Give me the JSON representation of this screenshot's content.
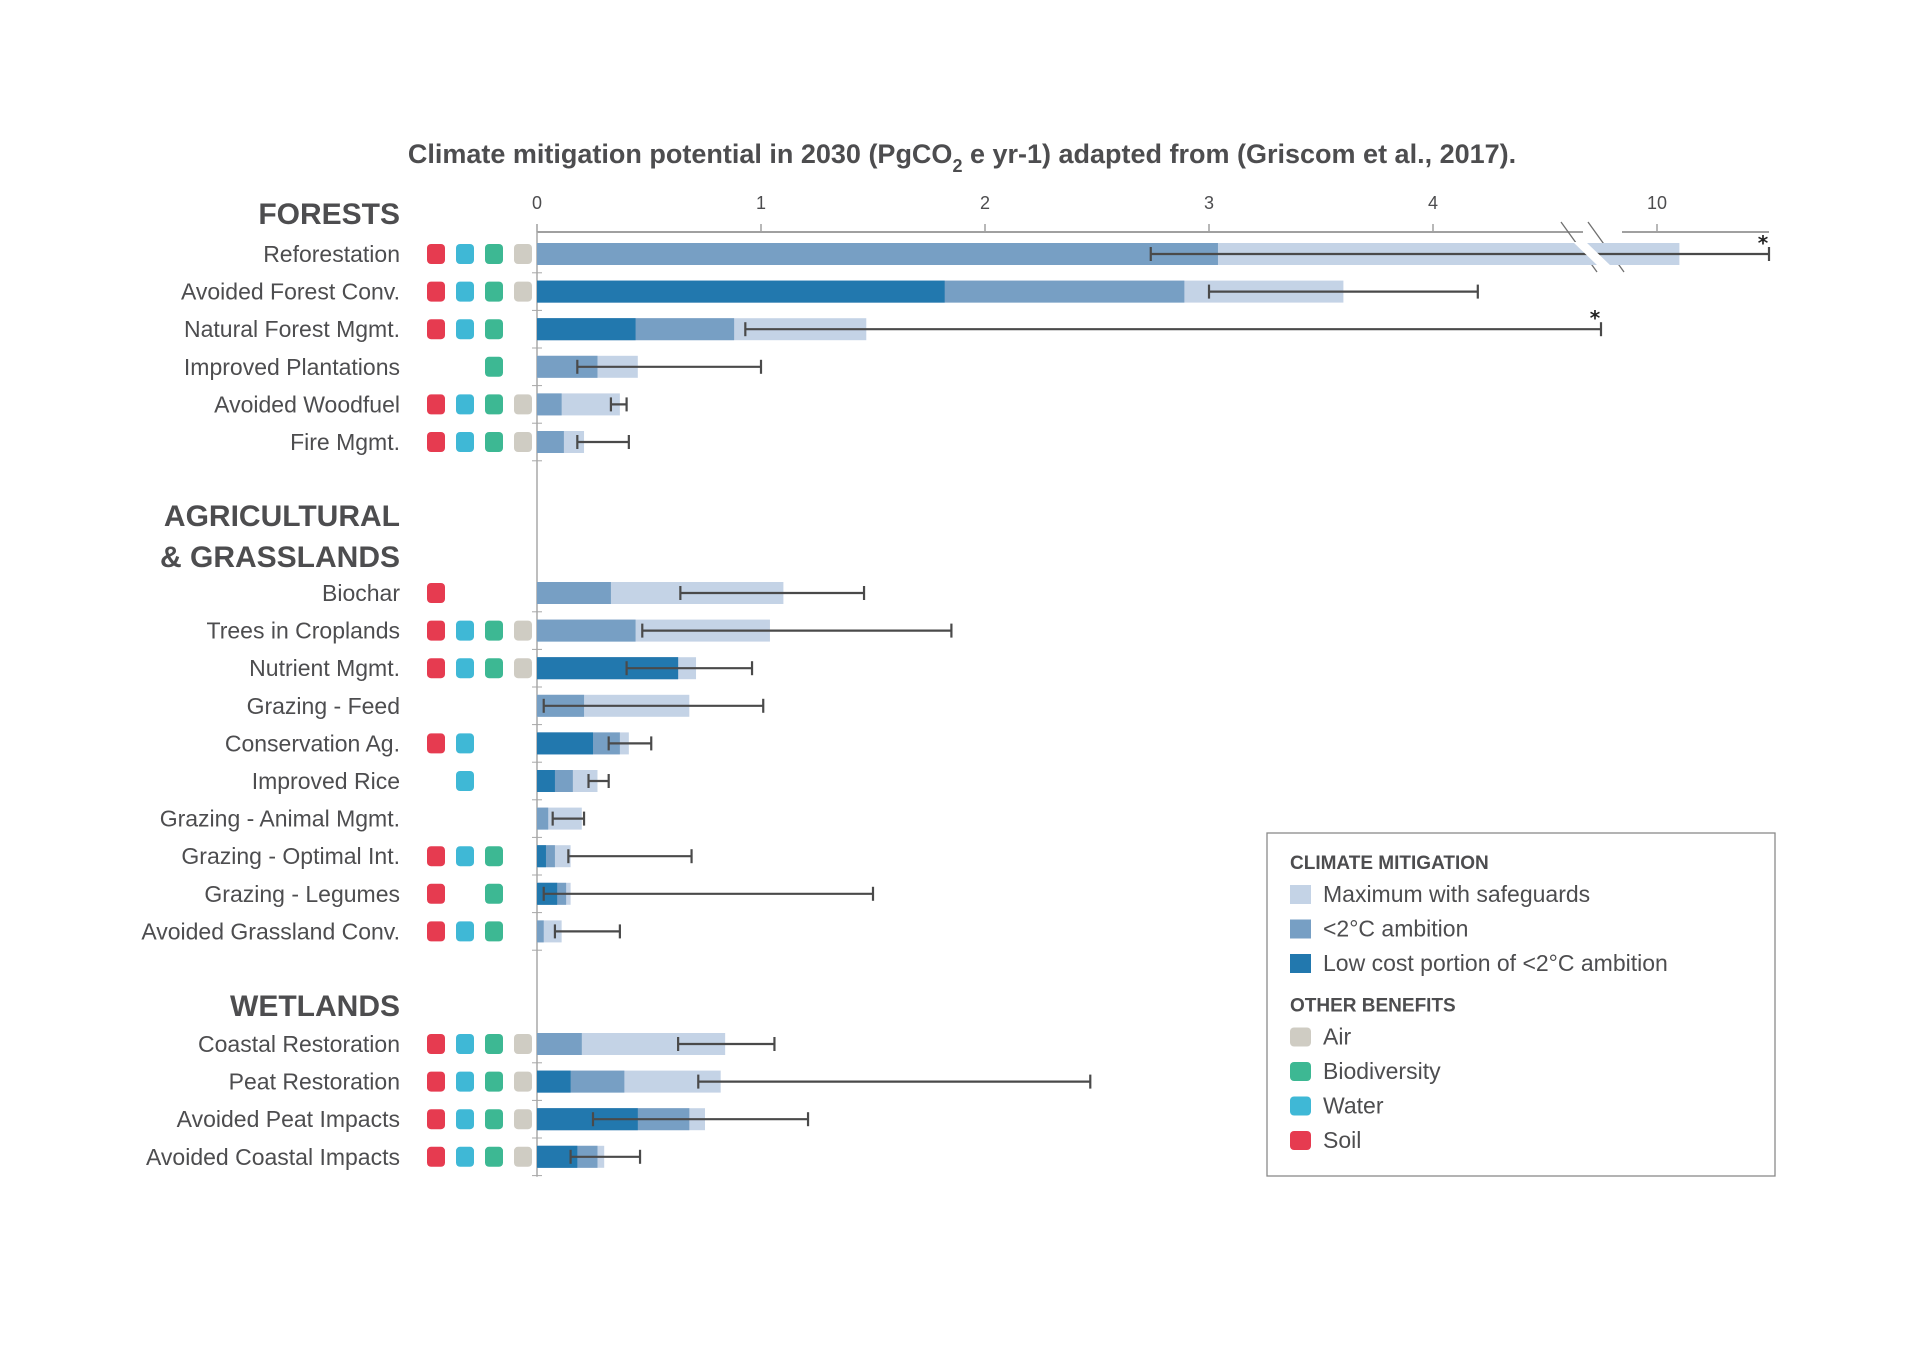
{
  "chart_data": {
    "type": "bar",
    "orientation": "horizontal",
    "stacked": true,
    "title_parts": {
      "before": "Climate mitigation potential in 2030 (PgCO",
      "subscript": "2",
      "after": " e yr-1) adapted from (Griscom et al., 2017)."
    },
    "title": "Climate mitigation potential in 2030 (PgCO2 e yr-1) adapted from (Griscom et al., 2017).",
    "xlabel": "",
    "ylabel": "",
    "x_ticks": [
      0,
      1,
      2,
      3,
      4,
      10
    ],
    "x_tick_labels": [
      "0",
      "1",
      "2",
      "3",
      "4",
      "10"
    ],
    "xlim": [
      0,
      10.5
    ],
    "axis_break": {
      "from": 4.8,
      "to": 9.8
    },
    "grid": false,
    "series": [
      {
        "key": "max",
        "name": "Maximum with safeguards",
        "color": "#C4D3E6"
      },
      {
        "key": "ambition",
        "name": "<2°C ambition",
        "color": "#779FC4"
      },
      {
        "key": "lowcost",
        "name": "Low cost portion of <2°C ambition",
        "color": "#2278AE"
      }
    ],
    "benefit_types": [
      {
        "key": "soil",
        "name": "Soil",
        "color": "#E63B50"
      },
      {
        "key": "water",
        "name": "Water",
        "color": "#3FB8D6"
      },
      {
        "key": "biodiversity",
        "name": "Biodiversity",
        "color": "#3DB893"
      },
      {
        "key": "air",
        "name": "Air",
        "color": "#CFCCC3"
      }
    ],
    "groups": [
      {
        "name": "FORESTS",
        "name_lines": [
          "FORESTS"
        ],
        "rows": [
          {
            "label": "Reforestation",
            "lowcost": 0,
            "ambition": 3.04,
            "max": 10.1,
            "err": [
              2.74,
              10.5
            ],
            "truncated": true,
            "benefits": [
              "soil",
              "water",
              "biodiversity",
              "air"
            ]
          },
          {
            "label": "Avoided Forest Conv.",
            "lowcost": 1.82,
            "ambition": 2.89,
            "max": 3.6,
            "err": [
              3.0,
              4.2
            ],
            "truncated": false,
            "benefits": [
              "soil",
              "water",
              "biodiversity",
              "air"
            ]
          },
          {
            "label": "Natural Forest Mgmt.",
            "lowcost": 0.44,
            "ambition": 0.88,
            "max": 1.47,
            "err": [
              0.93,
              4.75
            ],
            "truncated": true,
            "benefits": [
              "soil",
              "water",
              "biodiversity"
            ]
          },
          {
            "label": "Improved Plantations",
            "lowcost": 0,
            "ambition": 0.27,
            "max": 0.45,
            "err": [
              0.18,
              1.0
            ],
            "truncated": false,
            "benefits": [
              "biodiversity"
            ]
          },
          {
            "label": "Avoided Woodfuel",
            "lowcost": 0,
            "ambition": 0.11,
            "max": 0.37,
            "err": [
              0.33,
              0.4
            ],
            "truncated": false,
            "benefits": [
              "soil",
              "water",
              "biodiversity",
              "air"
            ]
          },
          {
            "label": "Fire Mgmt.",
            "lowcost": 0,
            "ambition": 0.12,
            "max": 0.21,
            "err": [
              0.18,
              0.41
            ],
            "truncated": false,
            "benefits": [
              "soil",
              "water",
              "biodiversity",
              "air"
            ]
          }
        ]
      },
      {
        "name": "AGRICULTURAL & GRASSLANDS",
        "name_lines": [
          "AGRICULTURAL",
          "& GRASSLANDS"
        ],
        "rows": [
          {
            "label": "Biochar",
            "lowcost": 0,
            "ambition": 0.33,
            "max": 1.1,
            "err": [
              0.64,
              1.46
            ],
            "truncated": false,
            "benefits": [
              "soil"
            ]
          },
          {
            "label": "Trees in Croplands",
            "lowcost": 0,
            "ambition": 0.44,
            "max": 1.04,
            "err": [
              0.47,
              1.85
            ],
            "truncated": false,
            "benefits": [
              "soil",
              "water",
              "biodiversity",
              "air"
            ]
          },
          {
            "label": "Nutrient Mgmt.",
            "lowcost": 0.63,
            "ambition": 0.63,
            "max": 0.71,
            "err": [
              0.4,
              0.96
            ],
            "truncated": false,
            "benefits": [
              "soil",
              "water",
              "biodiversity",
              "air"
            ]
          },
          {
            "label": "Grazing - Feed",
            "lowcost": 0,
            "ambition": 0.21,
            "max": 0.68,
            "err": [
              0.03,
              1.01
            ],
            "truncated": false,
            "benefits": []
          },
          {
            "label": "Conservation Ag.",
            "lowcost": 0.25,
            "ambition": 0.37,
            "max": 0.41,
            "err": [
              0.32,
              0.51
            ],
            "truncated": false,
            "benefits": [
              "soil",
              "water"
            ]
          },
          {
            "label": "Improved Rice",
            "lowcost": 0.08,
            "ambition": 0.16,
            "max": 0.27,
            "err": [
              0.23,
              0.32
            ],
            "truncated": false,
            "benefits": [
              "water"
            ]
          },
          {
            "label": "Grazing - Animal Mgmt.",
            "lowcost": 0,
            "ambition": 0.05,
            "max": 0.2,
            "err": [
              0.07,
              0.21
            ],
            "truncated": false,
            "benefits": []
          },
          {
            "label": "Grazing - Optimal Int.",
            "lowcost": 0.04,
            "ambition": 0.08,
            "max": 0.15,
            "err": [
              0.14,
              0.69
            ],
            "truncated": false,
            "benefits": [
              "soil",
              "water",
              "biodiversity"
            ]
          },
          {
            "label": "Grazing - Legumes",
            "lowcost": 0.09,
            "ambition": 0.13,
            "max": 0.15,
            "err": [
              0.03,
              1.5
            ],
            "truncated": false,
            "benefits": [
              "soil",
              "biodiversity"
            ]
          },
          {
            "label": "Avoided Grassland Conv.",
            "lowcost": 0,
            "ambition": 0.03,
            "max": 0.11,
            "err": [
              0.08,
              0.37
            ],
            "truncated": false,
            "benefits": [
              "soil",
              "water",
              "biodiversity"
            ]
          }
        ]
      },
      {
        "name": "WETLANDS",
        "name_lines": [
          "WETLANDS"
        ],
        "rows": [
          {
            "label": "Coastal Restoration",
            "lowcost": 0,
            "ambition": 0.2,
            "max": 0.84,
            "err": [
              0.63,
              1.06
            ],
            "truncated": false,
            "benefits": [
              "soil",
              "water",
              "biodiversity",
              "air"
            ]
          },
          {
            "label": "Peat Restoration",
            "lowcost": 0.15,
            "ambition": 0.39,
            "max": 0.82,
            "err": [
              0.72,
              2.47
            ],
            "truncated": false,
            "benefits": [
              "soil",
              "water",
              "biodiversity",
              "air"
            ]
          },
          {
            "label": "Avoided Peat Impacts",
            "lowcost": 0.45,
            "ambition": 0.68,
            "max": 0.75,
            "err": [
              0.25,
              1.21
            ],
            "truncated": false,
            "benefits": [
              "soil",
              "water",
              "biodiversity",
              "air"
            ]
          },
          {
            "label": "Avoided Coastal Impacts",
            "lowcost": 0.18,
            "ambition": 0.27,
            "max": 0.3,
            "err": [
              0.15,
              0.46
            ],
            "truncated": false,
            "benefits": [
              "soil",
              "water",
              "biodiversity",
              "air"
            ]
          }
        ]
      }
    ],
    "legend": {
      "placement": "bottom-right",
      "sections": [
        {
          "title": "CLIMATE MITIGATION",
          "items": [
            {
              "label": "Maximum with safeguards",
              "color": "#C4D3E6",
              "shape": "square"
            },
            {
              "label": "<2°C ambition",
              "color": "#779FC4",
              "shape": "square"
            },
            {
              "label": "Low cost portion of <2°C ambition",
              "color": "#2278AE",
              "shape": "square"
            }
          ]
        },
        {
          "title": "OTHER BENEFITS",
          "items": [
            {
              "label": "Air",
              "color": "#CFCCC3",
              "shape": "rounded"
            },
            {
              "label": "Biodiversity",
              "color": "#3DB893",
              "shape": "rounded"
            },
            {
              "label": "Water",
              "color": "#3FB8D6",
              "shape": "rounded"
            },
            {
              "label": "Soil",
              "color": "#E63B50",
              "shape": "rounded"
            }
          ]
        }
      ]
    },
    "annotations": [
      {
        "text": "*",
        "meaning": "error bar truncated",
        "rows": [
          "Reforestation",
          "Natural Forest Mgmt."
        ]
      }
    ]
  }
}
